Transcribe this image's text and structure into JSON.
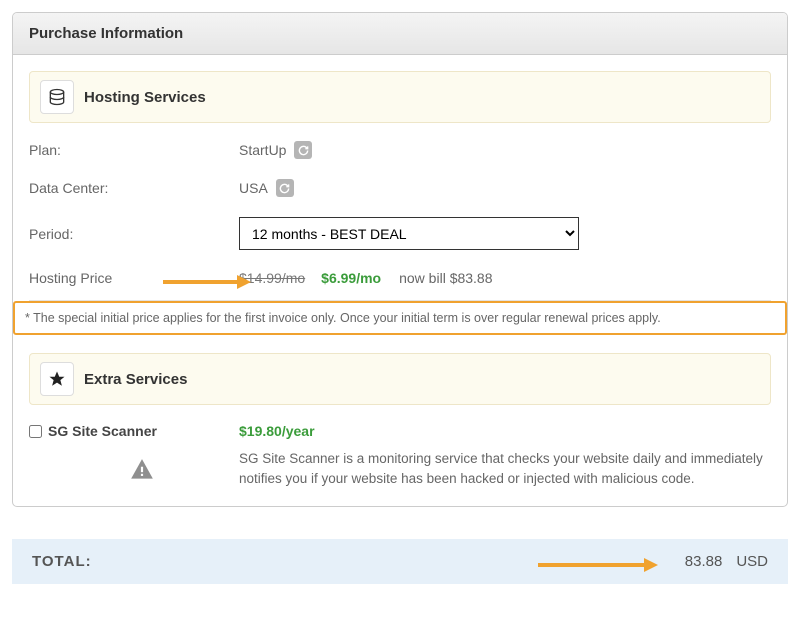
{
  "header": {
    "title": "Purchase Information"
  },
  "hosting": {
    "section_title": "Hosting Services",
    "plan_label": "Plan:",
    "plan_value": "StartUp",
    "datacenter_label": "Data Center:",
    "datacenter_value": "USA",
    "period_label": "Period:",
    "period_selected": "12 months - BEST DEAL",
    "price_label": "Hosting Price",
    "price_original": "$14.99/mo",
    "price_discounted": "$6.99/mo",
    "price_nowbill": "now bill $83.88"
  },
  "notice": {
    "text": "* The special initial price applies for the first invoice only. Once your initial term is over regular renewal prices apply."
  },
  "extras": {
    "section_title": "Extra Services",
    "scanner_name": "SG Site Scanner",
    "scanner_price": "$19.80/year",
    "scanner_desc": "SG Site Scanner is a monitoring service that checks your website daily and immediately notifies you if your website has been hacked or injected with malicious code."
  },
  "total": {
    "label": "TOTAL:",
    "amount": "83.88",
    "currency": "USD"
  },
  "colors": {
    "accent_orange": "#f0a22f",
    "green": "#3b9c3b",
    "total_bg": "#e6f0f9"
  }
}
